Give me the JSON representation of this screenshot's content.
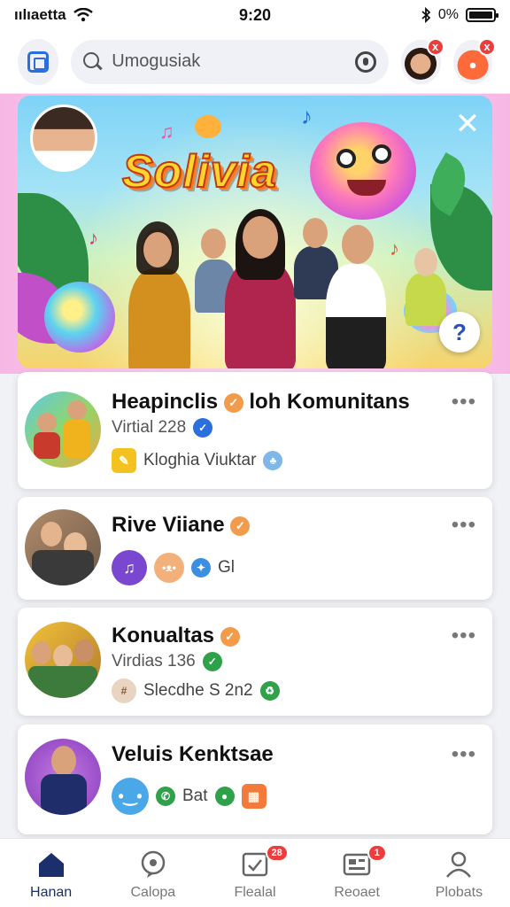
{
  "status_bar": {
    "carrier": "ıılıaetta",
    "time": "9:20",
    "battery_text": "0%",
    "icons": [
      "wifi-icon",
      "bluetooth-icon",
      "battery-icon"
    ]
  },
  "app_bar": {
    "search_placeholder": "Umogusiak",
    "badges": [
      "x",
      "x"
    ]
  },
  "banner": {
    "title": "Solivia",
    "close_label": "✕",
    "help_label": "?"
  },
  "cards": [
    {
      "title": "Heapinclis",
      "title_suffix": "loh Komunitans",
      "subtitle": "Virtial 228",
      "line": "Kloghia Viuktar"
    },
    {
      "title": "Rive Viiane",
      "line": "Gl"
    },
    {
      "title": "Konualtas",
      "subtitle": "Virdias 136",
      "line": "Slecdhe S 2n2"
    },
    {
      "title": "Veluis Kenktsae",
      "line": "Bat"
    }
  ],
  "bottom_nav": {
    "items": [
      {
        "label": "Hanan",
        "icon": "home-icon"
      },
      {
        "label": "Calopa",
        "icon": "chat-icon"
      },
      {
        "label": "Flealal",
        "icon": "feed-icon",
        "badge": "28"
      },
      {
        "label": "Reoaet",
        "icon": "messages-icon",
        "badge": "1"
      },
      {
        "label": "Plobats",
        "icon": "profile-icon"
      }
    ]
  },
  "colors": {
    "accent": "#2a6fdb",
    "nav_active": "#1a2f6b",
    "badge": "#ee3b3b",
    "verified": "#f29b4a",
    "banner_bg": "#f7b7e6"
  }
}
